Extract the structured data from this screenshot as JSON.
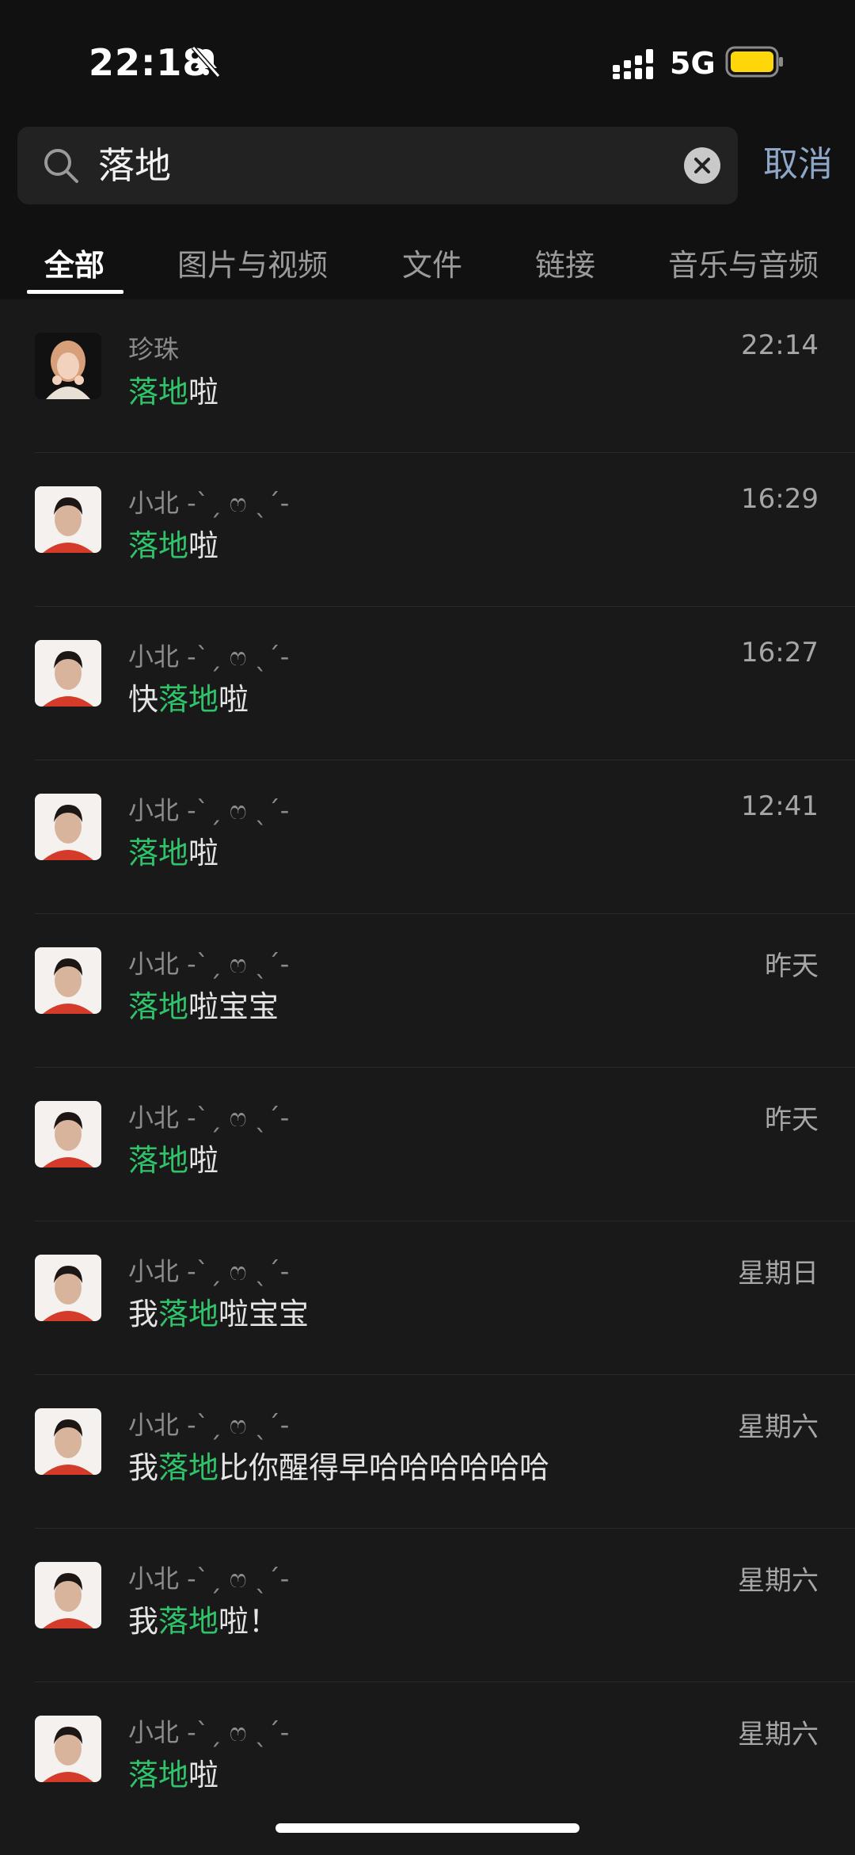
{
  "status_bar": {
    "time": "22:18",
    "network": "5G",
    "battery_color": "#ffd60a"
  },
  "search": {
    "query": "落地",
    "cancel_label": "取消"
  },
  "tabs": [
    {
      "label": "全部",
      "active": true
    },
    {
      "label": "图片与视频",
      "active": false
    },
    {
      "label": "文件",
      "active": false
    },
    {
      "label": "链接",
      "active": false
    },
    {
      "label": "音乐与音频",
      "active": false
    }
  ],
  "highlight_color": "#2fc36a",
  "results": [
    {
      "name": "珍珠",
      "date": "22:14",
      "pre": "",
      "hl": "落地",
      "post": "啦",
      "avatar": "girl-avatar"
    },
    {
      "name": "小北 -ˋˏ ෆ ˎˊ-",
      "date": "16:29",
      "pre": "",
      "hl": "落地",
      "post": "啦",
      "avatar": "boy-avatar"
    },
    {
      "name": "小北 -ˋˏ ෆ ˎˊ-",
      "date": "16:27",
      "pre": "快",
      "hl": "落地",
      "post": "啦",
      "avatar": "boy-avatar"
    },
    {
      "name": "小北 -ˋˏ ෆ ˎˊ-",
      "date": "12:41",
      "pre": "",
      "hl": "落地",
      "post": "啦",
      "avatar": "boy-avatar"
    },
    {
      "name": "小北 -ˋˏ ෆ ˎˊ-",
      "date": "昨天",
      "pre": "",
      "hl": "落地",
      "post": "啦宝宝",
      "avatar": "boy-avatar"
    },
    {
      "name": "小北 -ˋˏ ෆ ˎˊ-",
      "date": "昨天",
      "pre": "",
      "hl": "落地",
      "post": "啦",
      "avatar": "boy-avatar"
    },
    {
      "name": "小北 -ˋˏ ෆ ˎˊ-",
      "date": "星期日",
      "pre": "我",
      "hl": "落地",
      "post": "啦宝宝",
      "avatar": "boy-avatar"
    },
    {
      "name": "小北 -ˋˏ ෆ ˎˊ-",
      "date": "星期六",
      "pre": "我",
      "hl": "落地",
      "post": "比你醒得早哈哈哈哈哈哈",
      "avatar": "boy-avatar"
    },
    {
      "name": "小北 -ˋˏ ෆ ˎˊ-",
      "date": "星期六",
      "pre": "我",
      "hl": "落地",
      "post": "啦！",
      "avatar": "boy-avatar"
    },
    {
      "name": "小北 -ˋˏ ෆ ˎˊ-",
      "date": "星期六",
      "pre": "",
      "hl": "落地",
      "post": "啦",
      "avatar": "boy-avatar"
    }
  ]
}
